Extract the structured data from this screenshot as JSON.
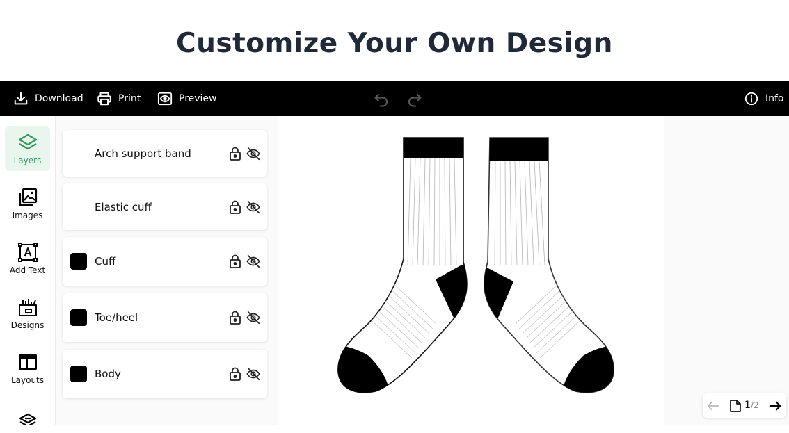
{
  "page": {
    "title": "Customize Your Own Design"
  },
  "toolbar": {
    "download_label": "Download",
    "print_label": "Print",
    "preview_label": "Preview",
    "info_label": "Info"
  },
  "sidebar": {
    "items": [
      {
        "label": "Layers",
        "icon": "layers-icon",
        "active": true
      },
      {
        "label": "Images",
        "icon": "images-icon"
      },
      {
        "label": "Add Text",
        "icon": "text-box-icon"
      },
      {
        "label": "Designs",
        "icon": "designs-icon"
      },
      {
        "label": "Layouts",
        "icon": "layout-icon"
      },
      {
        "label": "",
        "icon": "layers-stack-icon"
      }
    ]
  },
  "layers": [
    {
      "label": "Arch support band",
      "swatch": null
    },
    {
      "label": "Elastic cuff",
      "swatch": null
    },
    {
      "label": "Cuff",
      "swatch": "#000000"
    },
    {
      "label": "Toe/heel",
      "swatch": "#000000"
    },
    {
      "label": "Body",
      "swatch": "#000000"
    }
  ],
  "pagination": {
    "current": "1",
    "total": "/2"
  },
  "colors": {
    "accent": "#2e9b5a",
    "accent_bg": "#e9f6ee",
    "toolbar_bg": "#000000",
    "title": "#1f2937"
  }
}
